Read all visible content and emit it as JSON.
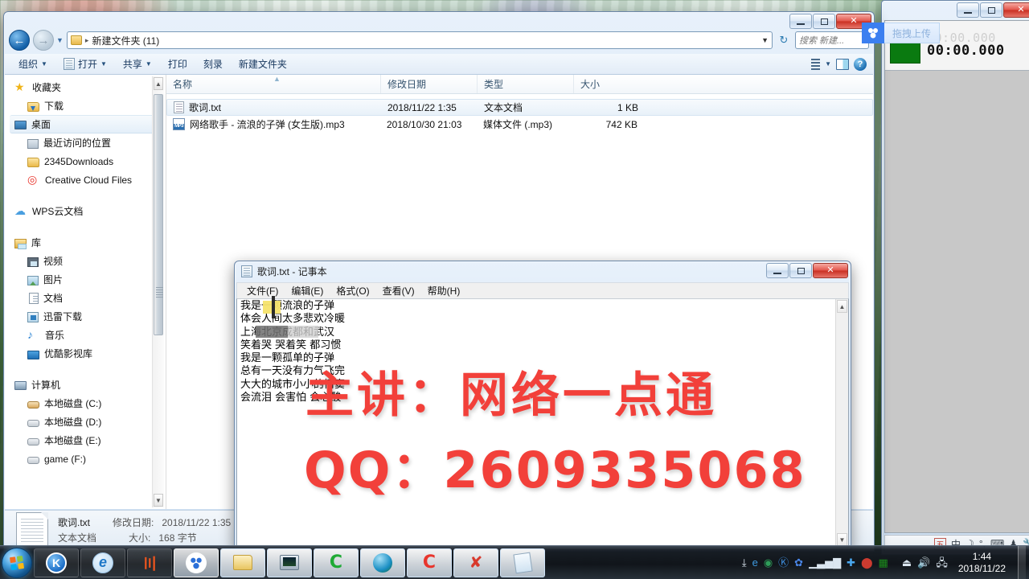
{
  "explorer": {
    "address": {
      "path": "新建文件夹 (11)",
      "separator": "▸"
    },
    "search_placeholder": "搜索 新建...",
    "toolbar": {
      "organize": "组织",
      "open": "打开",
      "share": "共享",
      "print": "打印",
      "burn": "刻录",
      "new_folder": "新建文件夹",
      "help_label": "?"
    },
    "sidebar": [
      {
        "label": "收藏夹",
        "icon": "star-icon",
        "level": 0,
        "selected": false
      },
      {
        "label": "下载",
        "icon": "downloads-folder-icon",
        "level": 1,
        "selected": false
      },
      {
        "label": "桌面",
        "icon": "desktop-icon",
        "level": 1,
        "selected": true
      },
      {
        "label": "最近访问的位置",
        "icon": "recent-places-icon",
        "level": 1,
        "selected": false
      },
      {
        "label": "2345Downloads",
        "icon": "folder-icon",
        "level": 1,
        "selected": false
      },
      {
        "label": "Creative Cloud Files",
        "icon": "creative-cloud-icon",
        "level": 1,
        "selected": false
      },
      {
        "label": "WPS云文档",
        "icon": "cloud-icon",
        "level": 0,
        "selected": false
      },
      {
        "label": "库",
        "icon": "library-icon",
        "level": 0,
        "selected": false
      },
      {
        "label": "视频",
        "icon": "video-icon",
        "level": 1,
        "selected": false
      },
      {
        "label": "图片",
        "icon": "pictures-icon",
        "level": 1,
        "selected": false
      },
      {
        "label": "文档",
        "icon": "documents-icon",
        "level": 1,
        "selected": false
      },
      {
        "label": "迅雷下载",
        "icon": "xunlei-icon",
        "level": 1,
        "selected": false
      },
      {
        "label": "音乐",
        "icon": "music-note-icon",
        "level": 1,
        "selected": false
      },
      {
        "label": "优酷影视库",
        "icon": "youku-icon",
        "level": 1,
        "selected": false
      },
      {
        "label": "计算机",
        "icon": "computer-icon",
        "level": 0,
        "selected": false
      },
      {
        "label": "本地磁盘 (C:)",
        "icon": "system-drive-icon",
        "level": 1,
        "selected": false
      },
      {
        "label": "本地磁盘 (D:)",
        "icon": "drive-icon",
        "level": 1,
        "selected": false
      },
      {
        "label": "本地磁盘 (E:)",
        "icon": "drive-icon",
        "level": 1,
        "selected": false
      },
      {
        "label": "game (F:)",
        "icon": "drive-icon",
        "level": 1,
        "selected": false
      }
    ],
    "columns": [
      "名称",
      "修改日期",
      "类型",
      "大小"
    ],
    "rows": [
      {
        "name": "歌词.txt",
        "date": "2018/11/22 1:35",
        "type": "文本文档",
        "size": "1 KB",
        "icon": "text-file-icon",
        "selected": true
      },
      {
        "name": "网络歌手 - 流浪的子弹 (女生版).mp3",
        "date": "2018/10/30 21:03",
        "type": "媒体文件 (.mp3)",
        "size": "742 KB",
        "icon": "mp3-file-icon",
        "selected": false
      }
    ],
    "details": {
      "filename": "歌词.txt",
      "modified_label": "修改日期:",
      "modified_value": "2018/11/22 1:35",
      "type_value": "文本文档",
      "size_label": "大小:",
      "size_value": "168 字节"
    }
  },
  "netdisk": {
    "drag_upload_label": "拖拽上传"
  },
  "right_window": {
    "timer_ghost": "00:00.000",
    "timer_main": "00:00.000",
    "ime_mode": "中",
    "ime_badge": "五"
  },
  "notepad": {
    "title": "歌词.txt - 记事本",
    "menu": [
      "文件(F)",
      "编辑(E)",
      "格式(O)",
      "查看(V)",
      "帮助(H)"
    ],
    "content": "我是一颗流浪的子弹\n体会人间太多悲欢冷暖\n上海北京成都和武汉\n笑着哭 哭着笑 都习惯\n我是一颗孤单的子弹\n总有一天没有力气飞完\n大大的城市小小的情窦\n会流泪 会害怕 会心酸"
  },
  "watermark": {
    "line1": "主讲：网络一点通",
    "line2": "QQ：2609335068",
    "color": "#f2403a"
  },
  "taskbar": {
    "buttons": [
      {
        "name": "kingsoft",
        "icon": "kingsoft-icon"
      },
      {
        "name": "ie-browser",
        "icon": "internet-explorer-icon"
      },
      {
        "name": "vegas",
        "icon": "vegas-icon"
      },
      {
        "name": "baidu-netdisk",
        "icon": "baidu-netdisk-icon"
      },
      {
        "name": "file-explorer",
        "icon": "folder-icon"
      },
      {
        "name": "screen-recorder",
        "icon": "monitor-icon"
      },
      {
        "name": "camtasia",
        "icon": "camtasia-green-icon"
      },
      {
        "name": "browser-globe",
        "icon": "globe-icon"
      },
      {
        "name": "camtasia-recorder",
        "icon": "camtasia-red-icon"
      },
      {
        "name": "close-app",
        "icon": "red-x-icon"
      },
      {
        "name": "notepad",
        "icon": "notepad-icon"
      }
    ],
    "tray": [
      "download-icon",
      "ie-icon",
      "globe-icon",
      "kingsoft-icon",
      "baidu-icon",
      "signal-icon",
      "bluetooth-icon",
      "shield-icon",
      "green-grid-icon"
    ],
    "tray_right": [
      "usb-eject-icon",
      "volume-icon",
      "network-error-icon"
    ],
    "clock_time": "1:44",
    "clock_date": "2018/11/22"
  }
}
